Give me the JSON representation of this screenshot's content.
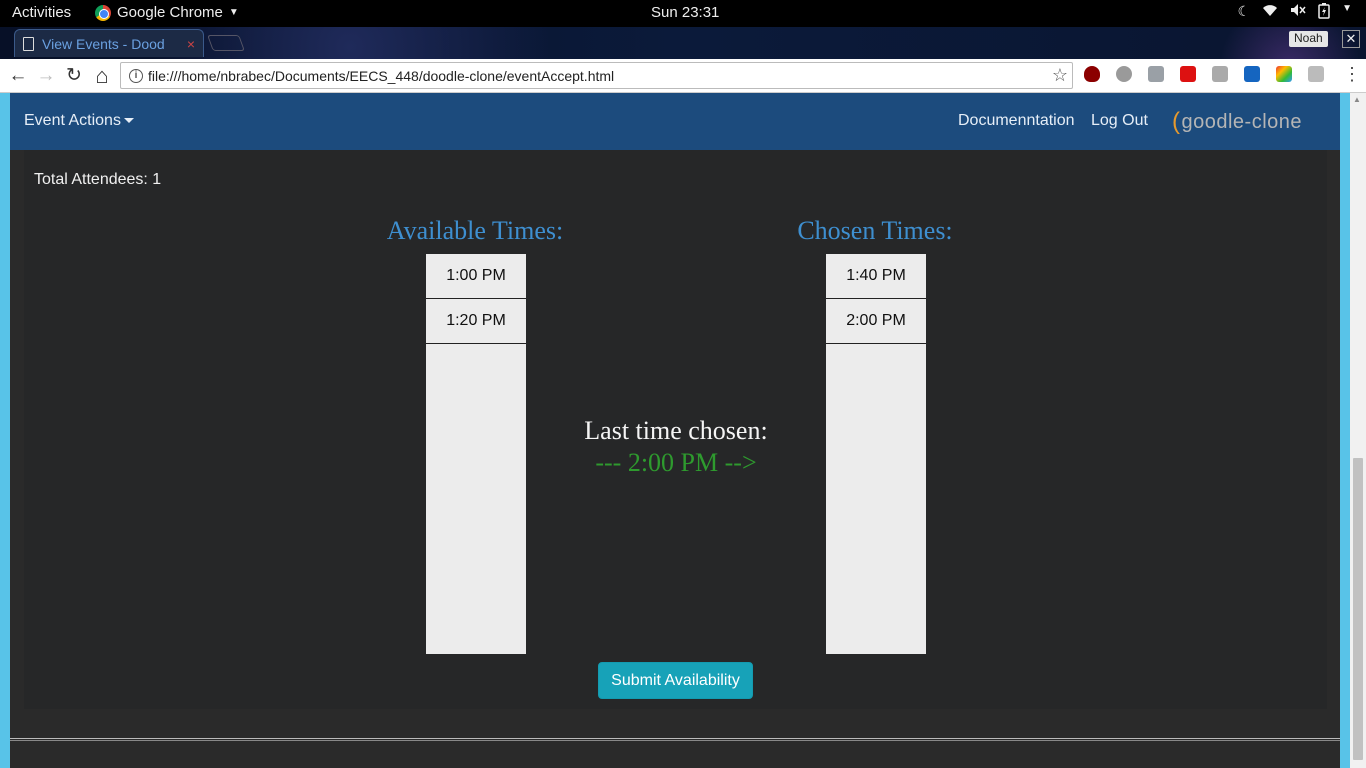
{
  "system": {
    "activities": "Activities",
    "app_name": "Google Chrome",
    "clock": "Sun 23:31",
    "tray_icons": [
      "night-light-icon",
      "wifi-icon",
      "volume-muted-icon",
      "battery-icon",
      "menu-arrow-icon"
    ]
  },
  "browser": {
    "tab_title": "View Events - Dood",
    "tab_close": "×",
    "profile_name": "Noah",
    "window_close": "✕",
    "url": "file:///home/nbrabec/Documents/EECS_448/doodle-clone/eventAccept.html",
    "back": "←",
    "forward": "→",
    "reload": "↻",
    "home": "⌂",
    "star": "☆",
    "info": "i",
    "menu": "⋮"
  },
  "navbar": {
    "actions_label": "Event Actions",
    "doc_label": "Documenntation",
    "logout_label": "Log Out",
    "brand_paren": "(",
    "brand_text": "goodle-clone"
  },
  "main": {
    "total_attendees": "Total Attendees: 1",
    "available_title": "Available Times:",
    "chosen_title": "Chosen Times:",
    "available_times": [
      "1:00 PM",
      "1:20 PM"
    ],
    "chosen_times": [
      "1:40 PM",
      "2:00 PM"
    ],
    "last_chosen_label": "Last time chosen:",
    "last_chosen_value": "--- 2:00 PM -->",
    "submit_label": "Submit Availability"
  },
  "colors": {
    "navbar_bg": "#1c4b7d",
    "accent_blue": "#3e8fd0",
    "chosen_green": "#2e9a2e",
    "submit_teal": "#17a2b8"
  }
}
